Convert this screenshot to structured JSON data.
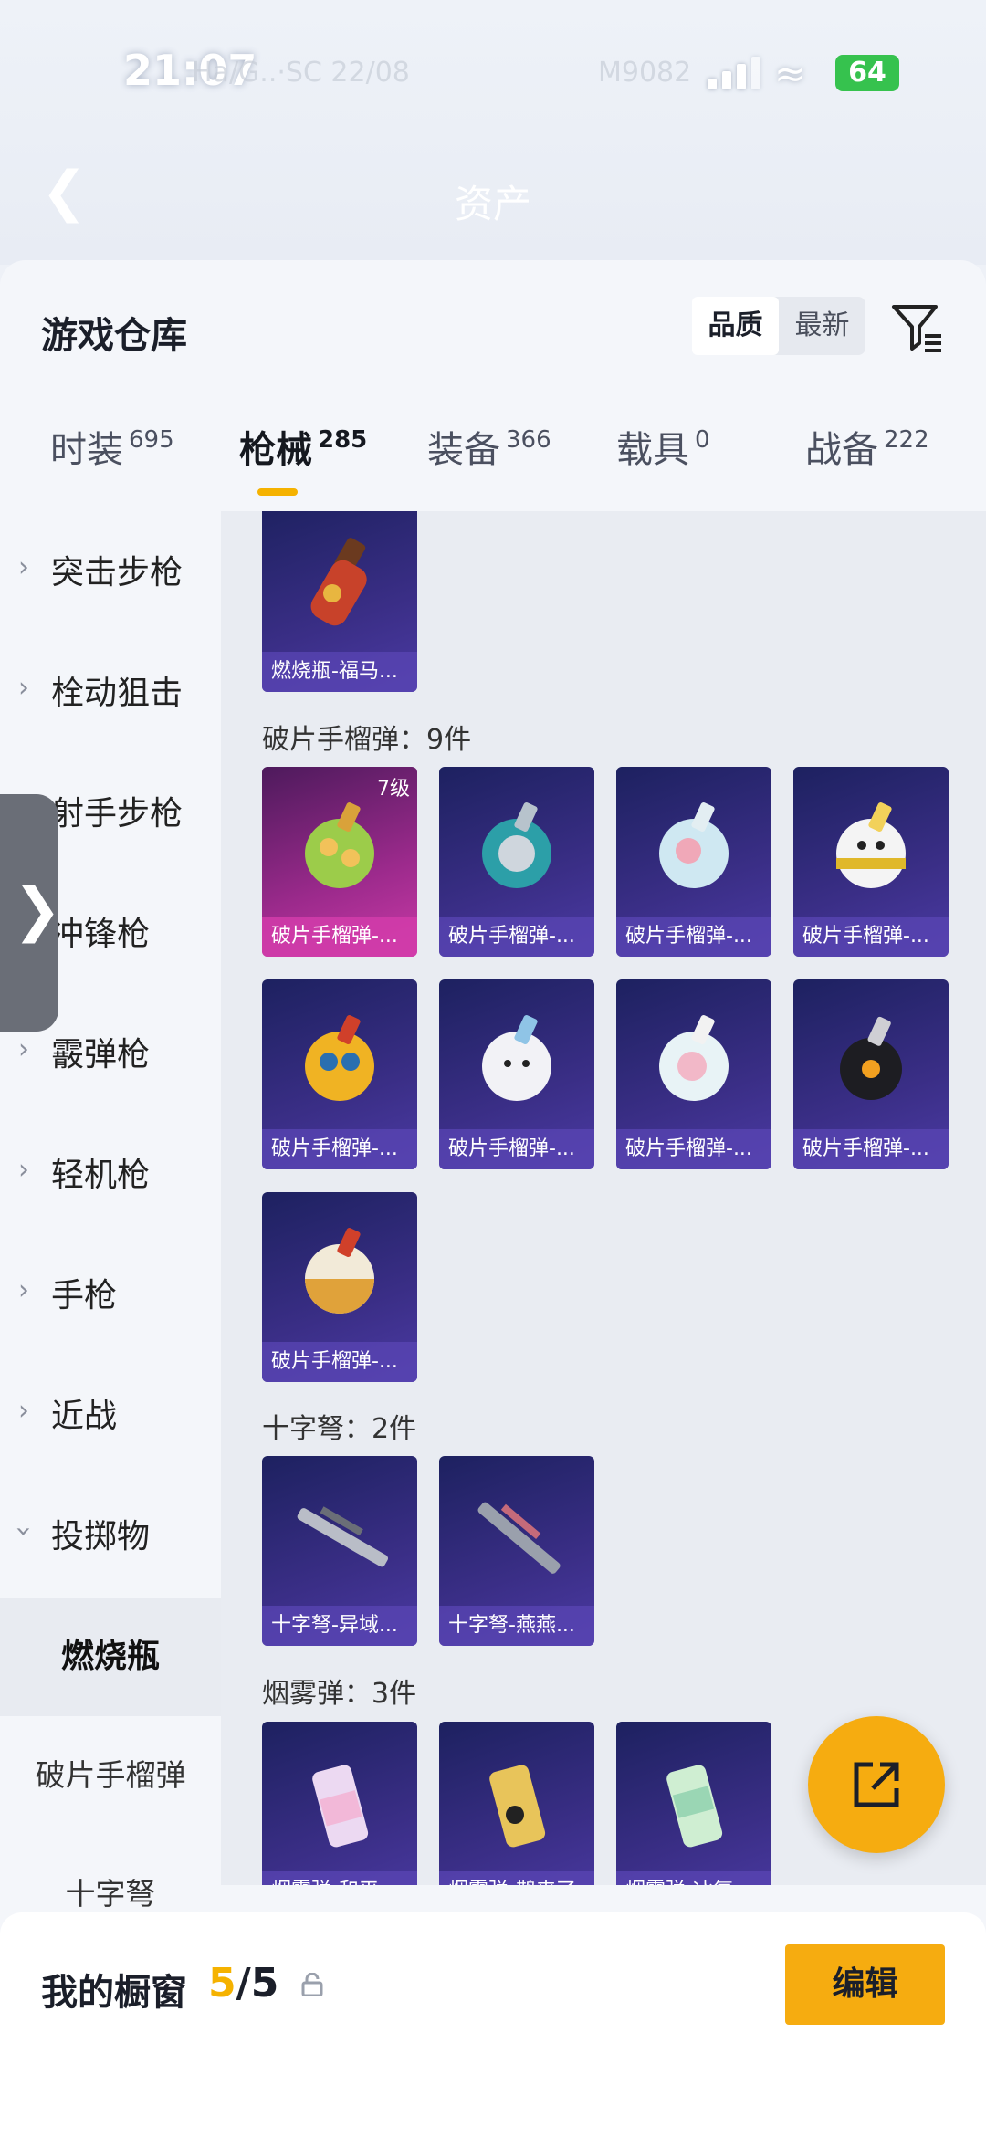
{
  "status": {
    "time": "21:07",
    "battery": "64",
    "faint_left": "Ha/G..·SC 22/08",
    "faint_center": "M9082"
  },
  "nav": {
    "title": "资产"
  },
  "header": {
    "title": "游戏仓库",
    "sort_quality": "品质",
    "sort_newest": "最新"
  },
  "tabs": [
    {
      "label": "时装",
      "count": "695"
    },
    {
      "label": "枪械",
      "count": "285"
    },
    {
      "label": "装备",
      "count": "366"
    },
    {
      "label": "载具",
      "count": "0"
    },
    {
      "label": "战备",
      "count": "222"
    }
  ],
  "categories": [
    "突击步枪",
    "栓动狙击",
    "射手步枪",
    "冲锋枪",
    "霰弹枪",
    "轻机枪",
    "手枪",
    "近战",
    "投掷物"
  ],
  "subcategories": [
    "燃烧瓶",
    "破片手榴弹",
    "十字弩"
  ],
  "sections": {
    "frag": "破片手榴弹：9件",
    "crossbow": "十字弩：2件",
    "smoke": "烟雾弹：3件"
  },
  "items": {
    "molotov": [
      "燃烧瓶-福马..."
    ],
    "frag_level": "7级",
    "frag": [
      "破片手榴弹-...",
      "破片手榴弹-...",
      "破片手榴弹-...",
      "破片手榴弹-...",
      "破片手榴弹-...",
      "破片手榴弹-...",
      "破片手榴弹-...",
      "破片手榴弹-...",
      "破片手榴弹-..."
    ],
    "crossbow": [
      "十字弩-异域...",
      "十字弩-燕燕..."
    ],
    "smoke": [
      "烟雾弹-和平...",
      "烟雾弹-鹊来了",
      "烟雾弹-冰氧..."
    ]
  },
  "bottom": {
    "title": "我的橱窗",
    "current": "5",
    "total": "/5",
    "edit": "编辑"
  },
  "colors": {
    "accent": "#f6ac10",
    "card": "#3a2e86",
    "card_rare": "#9c2a8c"
  }
}
